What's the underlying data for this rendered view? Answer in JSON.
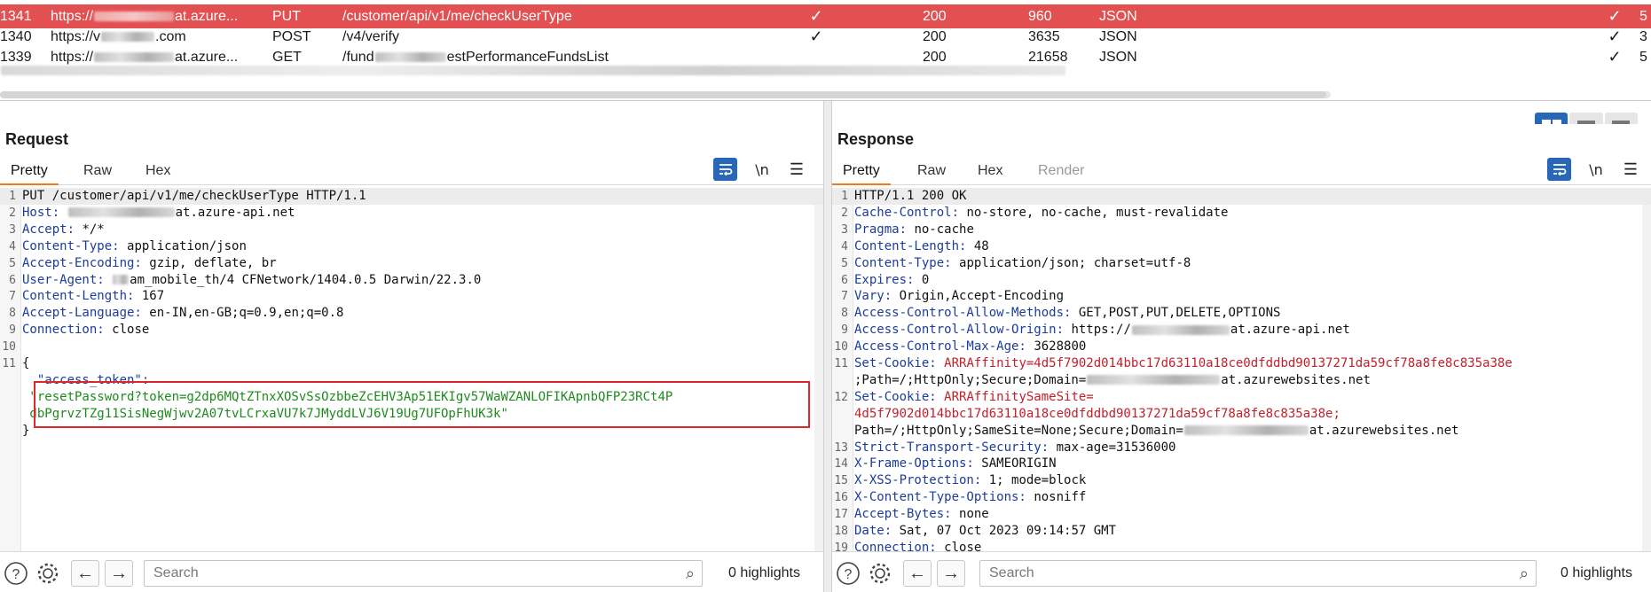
{
  "history": {
    "rows": [
      {
        "id": "1341",
        "host_prefix": "https://",
        "host_suffix": "at.azure...",
        "method": "PUT",
        "url_a": "/customer/api/v1/me/checkUserType",
        "url_b": "",
        "params": "✓",
        "status": "200",
        "length": "960",
        "mime": "JSON",
        "tick": "✓",
        "last": "5",
        "selected": true
      },
      {
        "id": "1340",
        "host_prefix": "https://v",
        "host_suffix": ".com",
        "method": "POST",
        "url_a": "/v4/verify",
        "url_b": "",
        "params": "✓",
        "status": "200",
        "length": "3635",
        "mime": "JSON",
        "tick": "✓",
        "last": "3",
        "selected": false
      },
      {
        "id": "1339",
        "host_prefix": "https://",
        "host_suffix": "at.azure...",
        "method": "GET",
        "url_a": "/fund",
        "url_b": "estPerformanceFundsList",
        "params": "",
        "status": "200",
        "length": "21658",
        "mime": "JSON",
        "tick": "✓",
        "last": "5",
        "selected": false
      }
    ]
  },
  "layout": {
    "options": [
      "split-vertical",
      "split-horizontal",
      "single"
    ]
  },
  "request": {
    "title": "Request",
    "tabs": [
      "Pretty",
      "Raw",
      "Hex"
    ],
    "active_tab": "Pretty",
    "lines": [
      {
        "n": "1",
        "text": "PUT /customer/api/v1/me/checkUserType HTTP/1.1"
      },
      {
        "n": "2",
        "key": "Host",
        "value_suffix": "at.azure-api.net"
      },
      {
        "n": "3",
        "key": "Accept",
        "value": "*/*"
      },
      {
        "n": "4",
        "key": "Content-Type",
        "value": "application/json"
      },
      {
        "n": "5",
        "key": "Accept-Encoding",
        "value": "gzip, deflate, br"
      },
      {
        "n": "6",
        "key": "User-Agent",
        "value": "am_mobile_th/4 CFNetwork/1404.0.5 Darwin/22.3.0"
      },
      {
        "n": "7",
        "key": "Content-Length",
        "value": "167"
      },
      {
        "n": "8",
        "key": "Accept-Language",
        "value": "en-IN,en-GB;q=0.9,en;q=0.8"
      },
      {
        "n": "9",
        "key": "Connection",
        "value": "close"
      },
      {
        "n": "10",
        "text": ""
      },
      {
        "n": "11",
        "text": "{"
      },
      {
        "n": "",
        "json_key": "\"access_token\":"
      },
      {
        "n": "",
        "json_str": "\"resetPassword?token=g2dp6MQtZTnxXOSvSsOzbbeZcEHV3Ap51EKIgv57WaWZANLOFIKApnbQFP23RCt4P"
      },
      {
        "n": "",
        "json_str": "dbPgrvzTZg11SisNegWjwv2A07tvLCrxaVU7k7JMyddLVJ6V19Ug7UFOpFhUK3k\""
      },
      {
        "n": "",
        "text": "}"
      }
    ]
  },
  "response": {
    "title": "Response",
    "tabs": [
      "Pretty",
      "Raw",
      "Hex",
      "Render"
    ],
    "active_tab": "Pretty",
    "lines": [
      {
        "n": "1",
        "text": "HTTP/1.1 200 OK"
      },
      {
        "n": "2",
        "key": "Cache-Control",
        "value": "no-store, no-cache, must-revalidate"
      },
      {
        "n": "3",
        "key": "Pragma",
        "value": "no-cache"
      },
      {
        "n": "4",
        "key": "Content-Length",
        "value": "48"
      },
      {
        "n": "5",
        "key": "Content-Type",
        "value": "application/json; charset=utf-8"
      },
      {
        "n": "6",
        "key": "Expires",
        "value": "0"
      },
      {
        "n": "7",
        "key": "Vary",
        "value": "Origin,Accept-Encoding"
      },
      {
        "n": "8",
        "key": "Access-Control-Allow-Methods",
        "value": "GET,POST,PUT,DELETE,OPTIONS"
      },
      {
        "n": "9",
        "key": "Access-Control-Allow-Origin",
        "value_prefix": "https://",
        "value_suffix": "at.azure-api.net"
      },
      {
        "n": "10",
        "key": "Access-Control-Max-Age",
        "value": "3628800"
      },
      {
        "n": "11",
        "key": "Set-Cookie",
        "cookie_name": "ARRAffinity",
        "cookie_val": "4d5f7902d014bbc17d63110a18ce0dfddbd90137271da59cf78a8fe8c835a38e"
      },
      {
        "n": "",
        "value_prefix": ";Path=/;HttpOnly;Secure;Domain=",
        "value_suffix": "at.azurewebsites.net"
      },
      {
        "n": "12",
        "key": "Set-Cookie",
        "cookie_name": "ARRAffinitySameSite",
        "cookie_val": ""
      },
      {
        "n": "",
        "red": "4d5f7902d014bbc17d63110a18ce0dfddbd90137271da59cf78a8fe8c835a38e;"
      },
      {
        "n": "",
        "value_prefix": "Path=/;HttpOnly;SameSite=None;Secure;Domain=",
        "value_suffix": "at.azurewebsites.net"
      },
      {
        "n": "13",
        "key": "Strict-Transport-Security",
        "value": "max-age=31536000"
      },
      {
        "n": "14",
        "key": "X-Frame-Options",
        "value": "SAMEORIGIN"
      },
      {
        "n": "15",
        "key": "X-XSS-Protection",
        "value": "1; mode=block"
      },
      {
        "n": "16",
        "key": "X-Content-Type-Options",
        "value": "nosniff"
      },
      {
        "n": "17",
        "key": "Accept-Bytes",
        "value": "none"
      },
      {
        "n": "18",
        "key": "Date",
        "value": "Sat, 07 Oct 2023 09:14:57 GMT"
      },
      {
        "n": "19",
        "key": "Connection",
        "value": "close"
      }
    ]
  },
  "footer": {
    "search_placeholder": "Search",
    "request_highlights": "0 highlights",
    "response_highlights": "0 highlights"
  },
  "icons": {
    "help": "help-icon",
    "settings": "gear-icon",
    "back": "arrow-left-icon",
    "forward": "arrow-right-icon",
    "search": "search-icon",
    "wrap": "word-wrap-icon",
    "newline": "newline-icon",
    "menu": "hamburger-menu-icon"
  },
  "colors": {
    "selected_row": "#e35052",
    "active_tab_underline": "#f07a1b",
    "accent": "#2866b8",
    "highlight_box": "#e0262a"
  }
}
